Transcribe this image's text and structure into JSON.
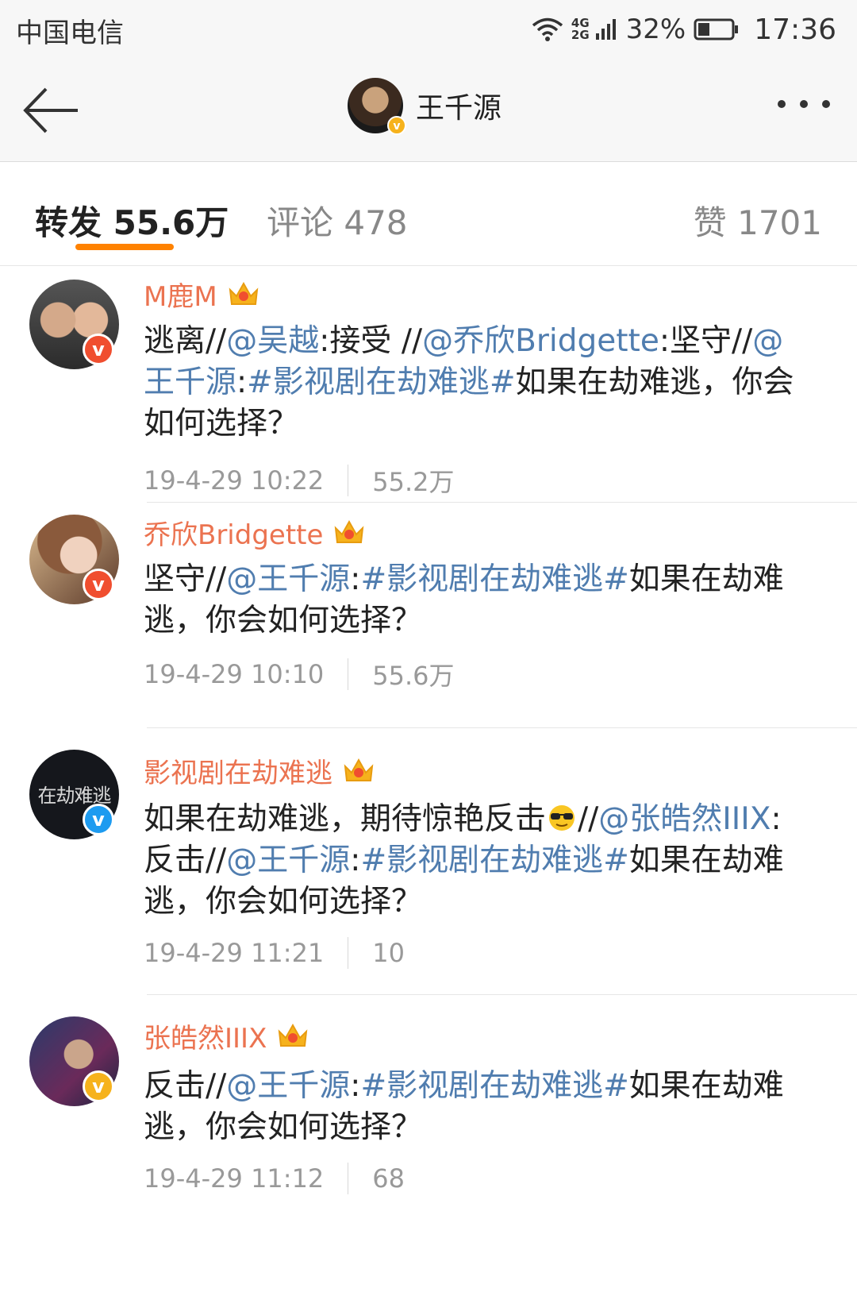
{
  "status_bar": {
    "carrier": "中国电信",
    "network_top": "4G",
    "network_bottom": "2G",
    "battery_percent": "32%",
    "time": "17:36"
  },
  "nav": {
    "title": "王千源"
  },
  "tabs": {
    "repost": "转发 55.6万",
    "comment": "评论 478",
    "like": "赞 1701"
  },
  "reposts": [
    {
      "name": "M鹿M",
      "badge": "red",
      "segments": [
        {
          "t": "逃离//",
          "link": false
        },
        {
          "t": "@吴越",
          "link": true
        },
        {
          "t": ":接受 //",
          "link": false
        },
        {
          "t": "@乔欣Bridgette",
          "link": true
        },
        {
          "t": ":坚守//",
          "link": false
        },
        {
          "t": "@王千源",
          "link": true
        },
        {
          "t": ":",
          "link": false
        },
        {
          "t": "#影视剧在劫难逃#",
          "link": true
        },
        {
          "t": "如果在劫难逃，你会如何选择？",
          "link": false
        }
      ],
      "time": "19-4-29 10:22",
      "count": "55.2万"
    },
    {
      "name": "乔欣Bridgette",
      "badge": "red",
      "segments": [
        {
          "t": "坚守//",
          "link": false
        },
        {
          "t": "@王千源",
          "link": true
        },
        {
          "t": ":",
          "link": false
        },
        {
          "t": "#影视剧在劫难逃#",
          "link": true
        },
        {
          "t": "如果在劫难逃，你会如何选择？",
          "link": false
        }
      ],
      "time": "19-4-29 10:10",
      "count": "55.6万"
    },
    {
      "name": "影视剧在劫难逃",
      "badge": "blue",
      "avatar_text": "在劫难逃",
      "segments": [
        {
          "t": "如果在劫难逃，期待惊艳反击",
          "link": false
        },
        {
          "t": "[emoji]",
          "link": false
        },
        {
          "t": "//",
          "link": false
        },
        {
          "t": "@张皓然IIIX",
          "link": true
        },
        {
          "t": ": 反击//",
          "link": false
        },
        {
          "t": "@王千源",
          "link": true
        },
        {
          "t": ":",
          "link": false
        },
        {
          "t": "#影视剧在劫难逃#",
          "link": true
        },
        {
          "t": "如果在劫难逃，你会如何选择？",
          "link": false
        }
      ],
      "time": "19-4-29 11:21",
      "count": "10"
    },
    {
      "name": "张皓然IIIX",
      "badge": "gold",
      "segments": [
        {
          "t": "反击//",
          "link": false
        },
        {
          "t": "@王千源",
          "link": true
        },
        {
          "t": ":",
          "link": false
        },
        {
          "t": "#影视剧在劫难逃#",
          "link": true
        },
        {
          "t": "如果在劫难逃，你会如何选择？",
          "link": false
        }
      ],
      "time": "19-4-29 11:12",
      "count": "68"
    }
  ],
  "colors": {
    "accent": "#ff8200",
    "username": "#eb7350",
    "link": "#507daf",
    "meta": "#999999"
  },
  "icons": {
    "back": "arrow-left-icon",
    "more": "more-dots-icon",
    "crown": "crown-icon",
    "verified": "verified-v-icon",
    "emoji": "cool-sunglasses-emoji-icon"
  }
}
